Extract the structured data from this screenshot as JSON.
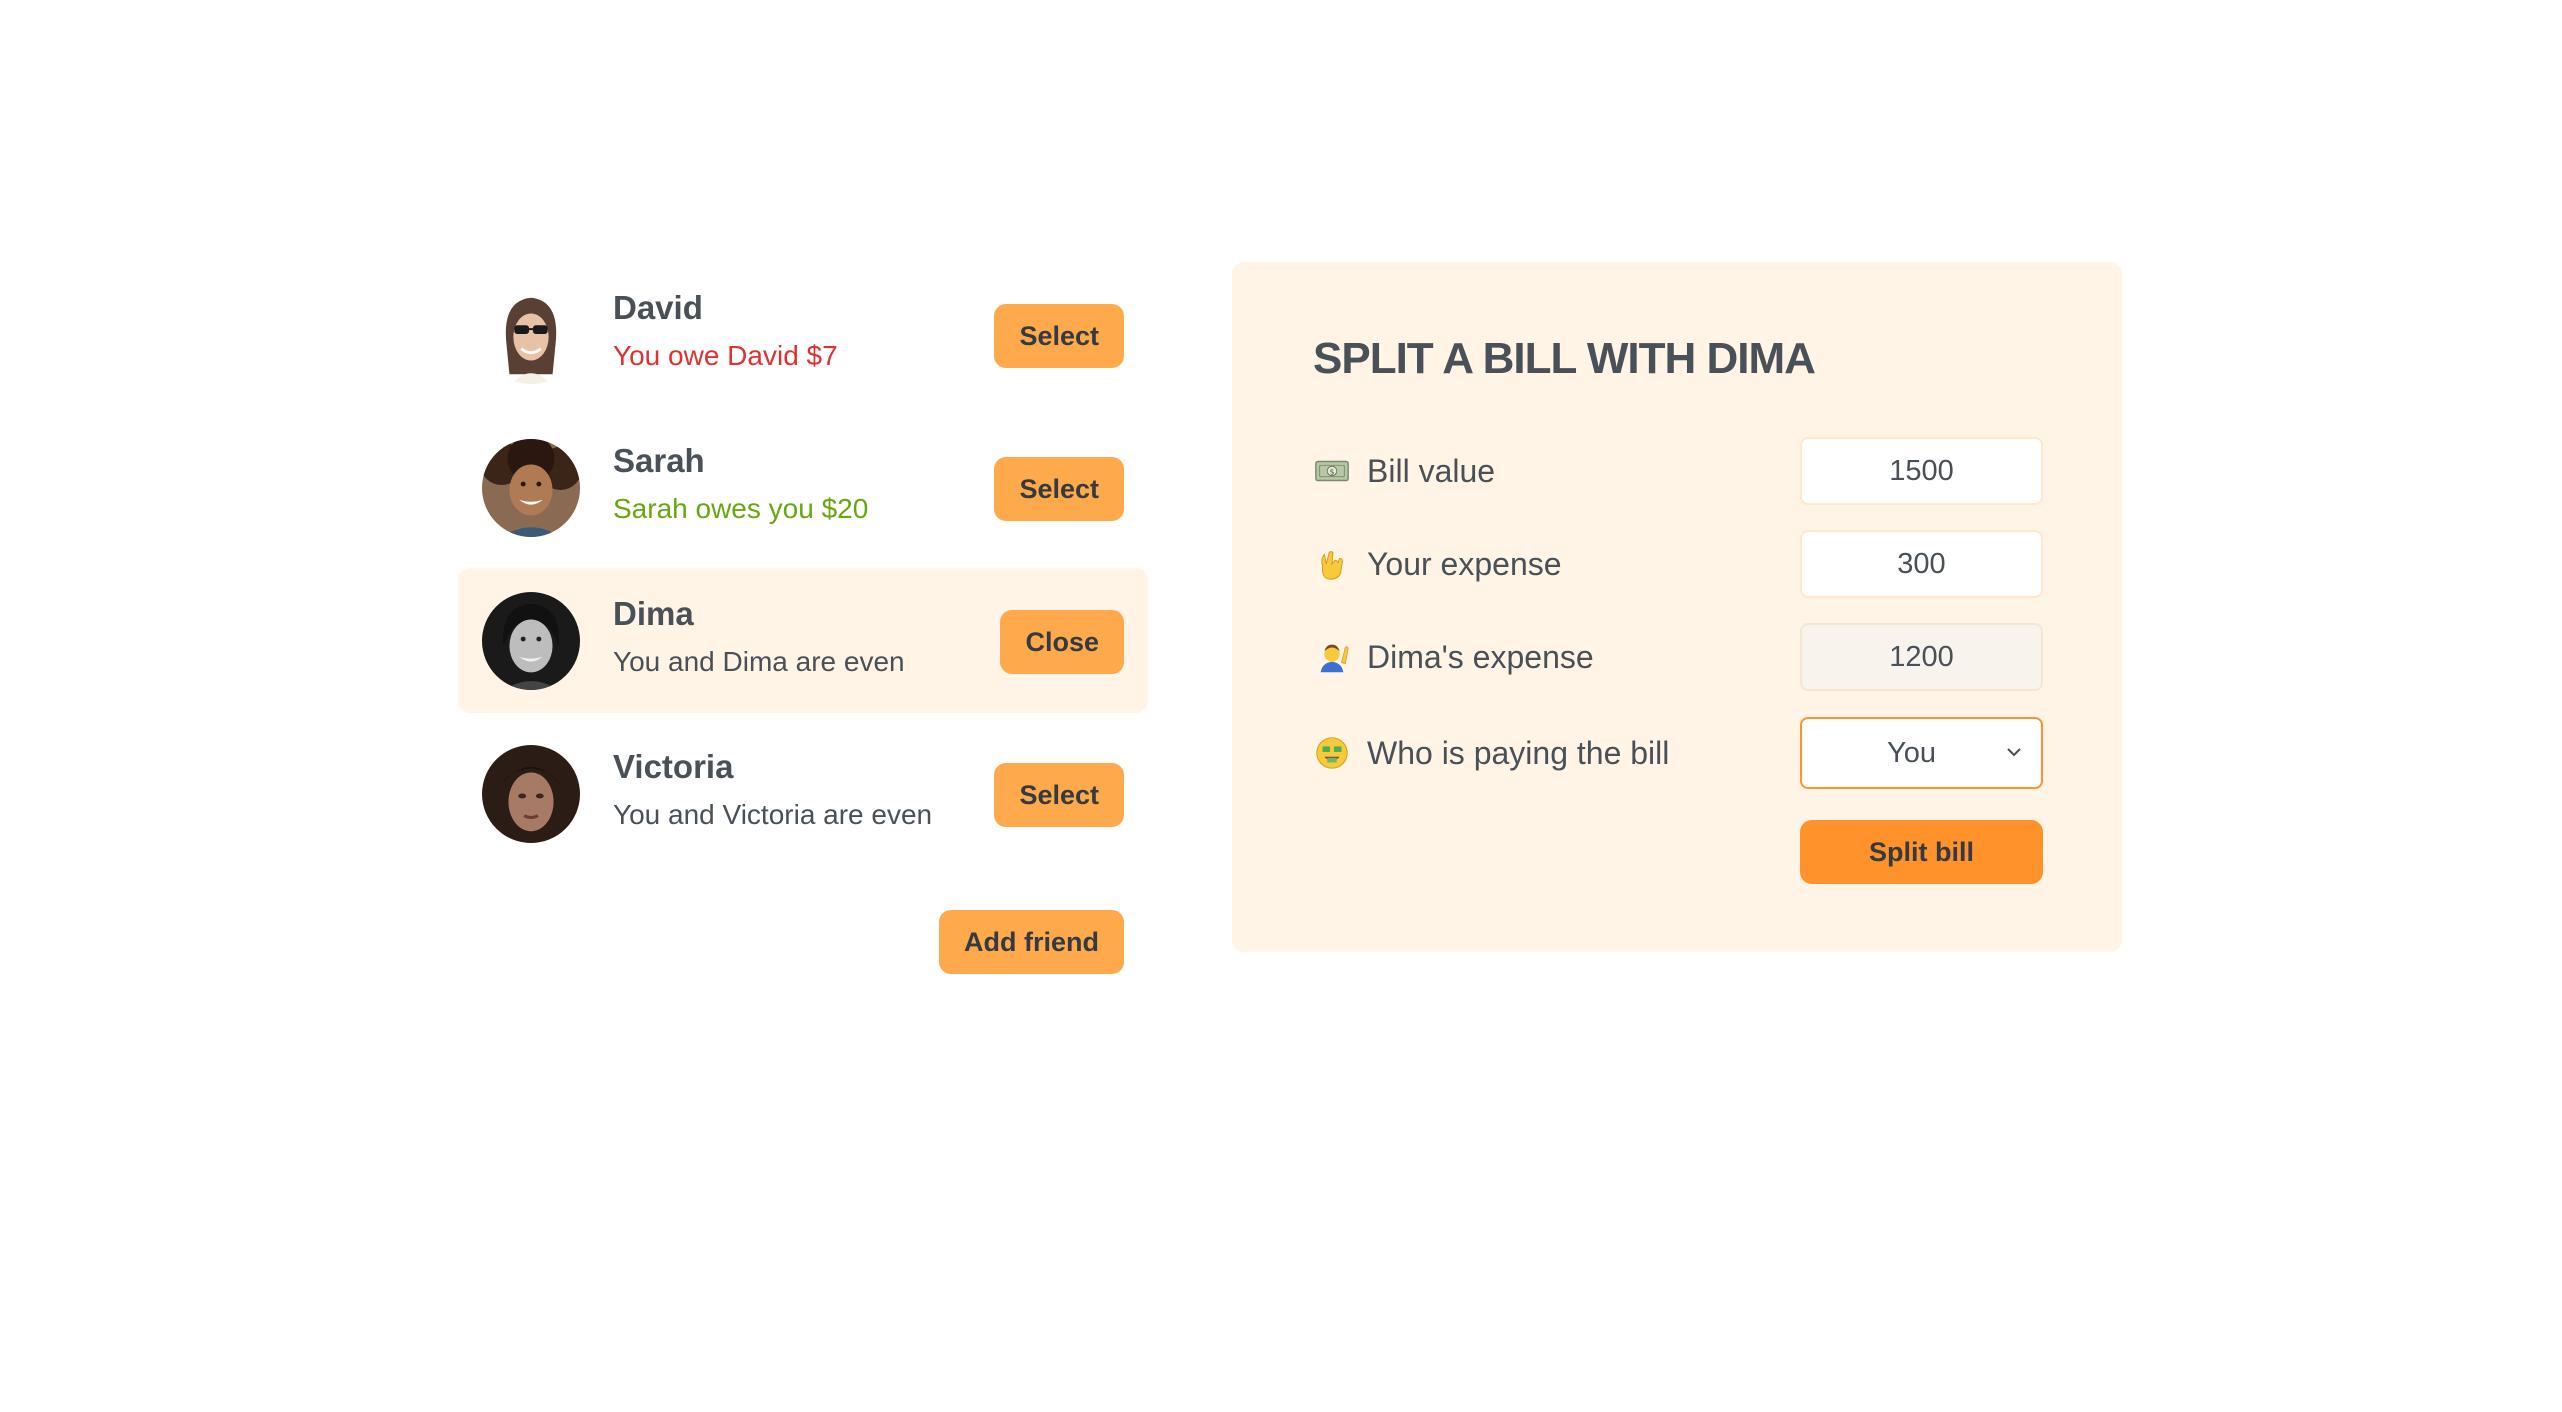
{
  "friends": [
    {
      "name": "David",
      "balance": "You owe David $7",
      "balance_type": "negative",
      "button": "Select",
      "selected": false
    },
    {
      "name": "Sarah",
      "balance": "Sarah owes you $20",
      "balance_type": "positive",
      "button": "Select",
      "selected": false
    },
    {
      "name": "Dima",
      "balance": "You and Dima are even",
      "balance_type": "even",
      "button": "Close",
      "selected": true
    },
    {
      "name": "Victoria",
      "balance": "You and Victoria are even",
      "balance_type": "even",
      "button": "Select",
      "selected": false
    }
  ],
  "add_friend_label": "Add friend",
  "form": {
    "title": "Split a bill with Dima",
    "bill_label": "Bill value",
    "bill_value": "1500",
    "bill_icon": "money-bill-icon",
    "your_expense_label": "Your expense",
    "your_expense_value": "300",
    "your_expense_icon": "rock-hand-icon",
    "friend_expense_label": "Dima's expense",
    "friend_expense_value": "1200",
    "friend_expense_icon": "person-raising-hand-icon",
    "payer_label": "Who is paying the bill",
    "payer_value": "You",
    "payer_icon": "money-mouth-face-icon",
    "submit_label": "Split bill"
  },
  "colors": {
    "accent": "#ffa94d",
    "accent_dark": "#ff922b",
    "panel_bg": "#fff4e6",
    "negative": "#e03131",
    "positive": "#66a80f",
    "text": "#495057"
  }
}
